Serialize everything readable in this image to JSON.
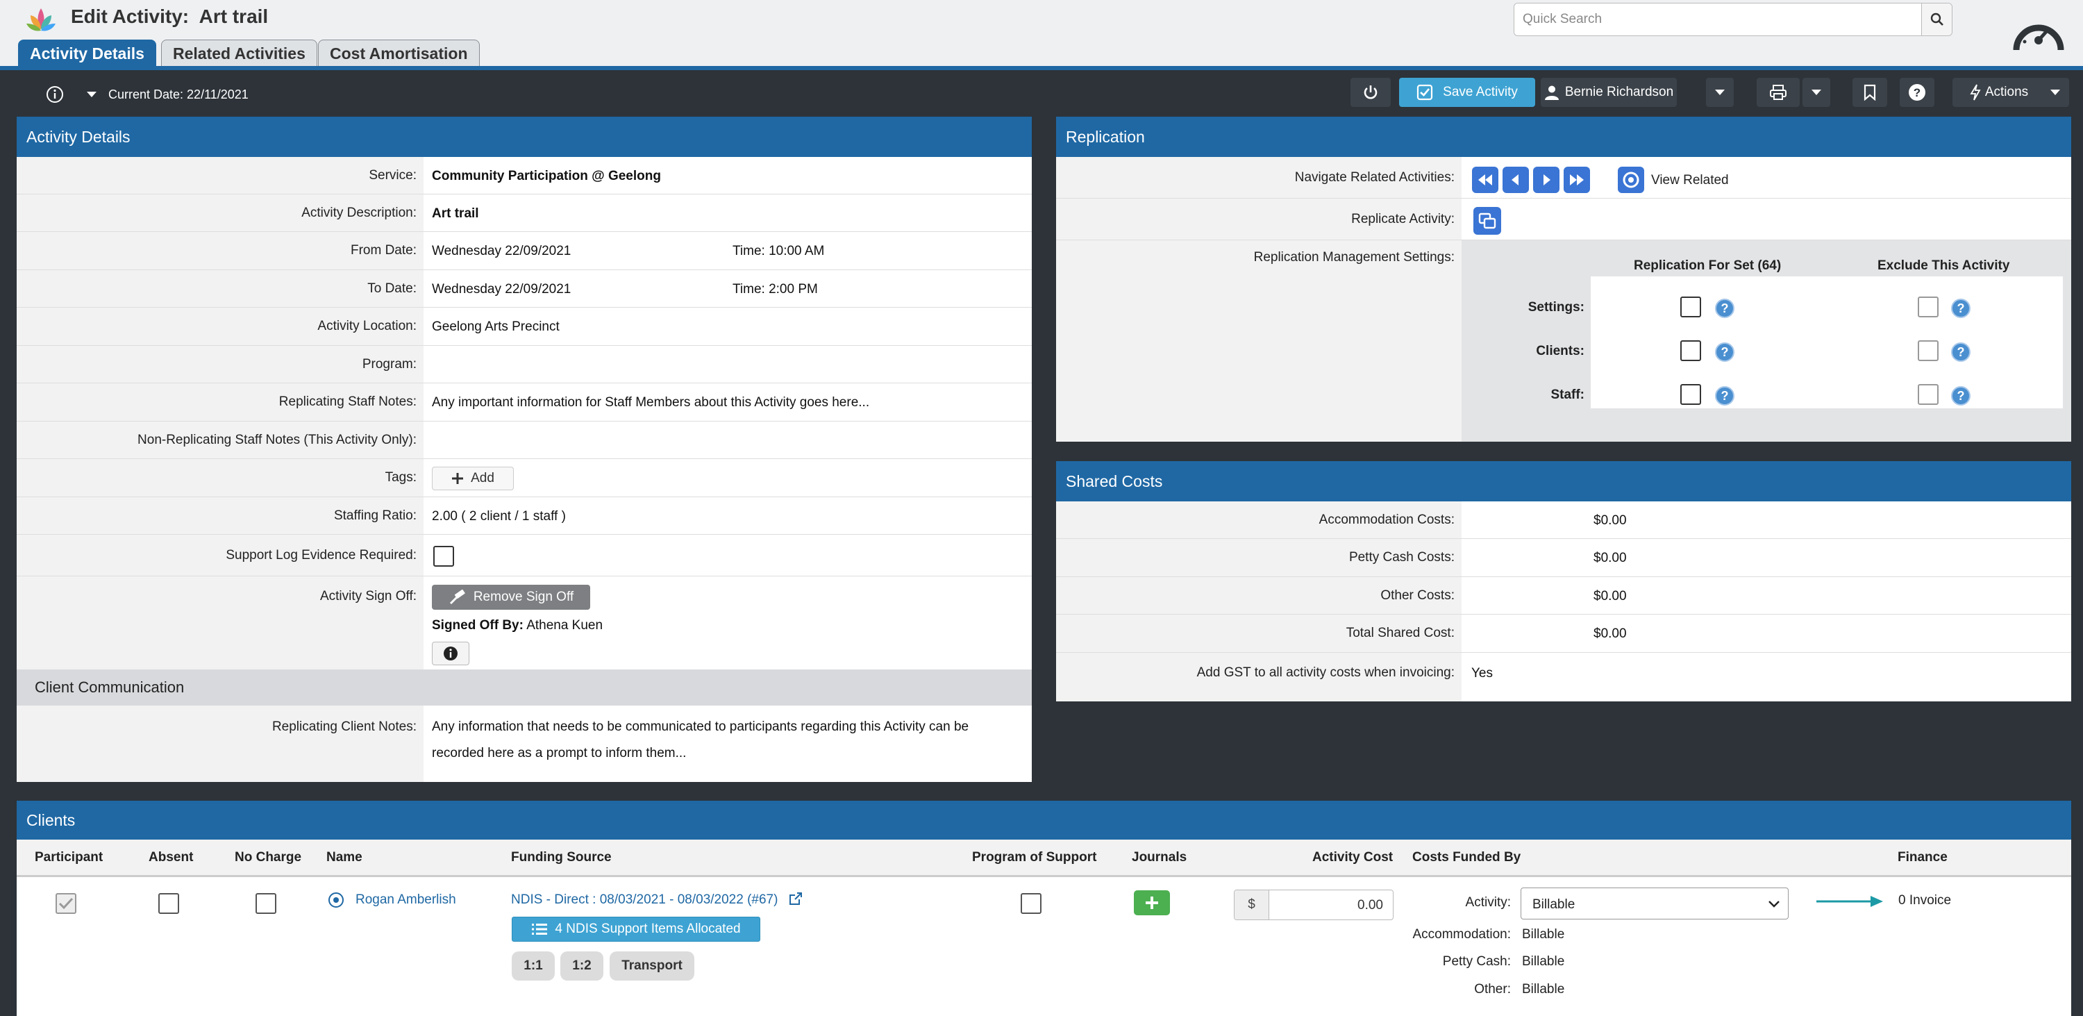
{
  "header": {
    "title_prefix": "Edit Activity:",
    "title_name": "Art trail",
    "search_placeholder": "Quick Search",
    "tabs": [
      {
        "label": "Activity Details"
      },
      {
        "label": "Related Activities"
      },
      {
        "label": "Cost Amortisation"
      }
    ]
  },
  "toolbar": {
    "current_date": "Current Date: 22/11/2021",
    "save_label": "Save Activity",
    "user_name": "Bernie Richardson",
    "actions_label": "Actions"
  },
  "activity_details": {
    "heading": "Activity Details",
    "service_label": "Service:",
    "service_value": "Community Participation @ Geelong",
    "description_label": "Activity Description:",
    "description_value": "Art trail",
    "from_label": "From Date:",
    "from_value": "Wednesday 22/09/2021",
    "from_time": "Time: 10:00 AM",
    "to_label": "To Date:",
    "to_value": "Wednesday 22/09/2021",
    "to_time": "Time: 2:00 PM",
    "location_label": "Activity Location:",
    "location_value": "Geelong Arts Precinct",
    "program_label": "Program:",
    "program_value": "",
    "rep_notes_label": "Replicating Staff Notes:",
    "rep_notes_value": "Any important information for Staff Members about this Activity goes here...",
    "nonrep_notes_label": "Non-Replicating Staff Notes (This Activity Only):",
    "nonrep_notes_value": "",
    "tags_label": "Tags:",
    "tags_add": "Add",
    "ratio_label": "Staffing Ratio:",
    "ratio_value": "2.00 ( 2 client / 1 staff )",
    "evidence_label": "Support Log Evidence Required:",
    "signoff_label": "Activity Sign Off:",
    "remove_signoff": "Remove Sign Off",
    "signed_off_by_label": "Signed Off By:",
    "signed_off_by_value": "Athena Kuen",
    "client_comm_heading": "Client Communication",
    "client_notes_label": "Replicating Client Notes:",
    "client_notes_line1": "Any information that needs to be communicated to participants regarding this Activity can be",
    "client_notes_line2": "recorded here as a prompt to inform them..."
  },
  "replication": {
    "heading": "Replication",
    "navigate_label": "Navigate Related Activities:",
    "view_related": "View Related",
    "replicate_label": "Replicate Activity:",
    "mgmt_label": "Replication Management Settings:",
    "col_set": "Replication For Set (64)",
    "col_exclude": "Exclude This Activity",
    "rows": [
      {
        "label": "Settings:"
      },
      {
        "label": "Clients:"
      },
      {
        "label": "Staff:"
      }
    ]
  },
  "shared_costs": {
    "heading": "Shared Costs",
    "rows": [
      {
        "label": "Accommodation Costs:",
        "value": "$0.00"
      },
      {
        "label": "Petty Cash Costs:",
        "value": "$0.00"
      },
      {
        "label": "Other Costs:",
        "value": "$0.00"
      },
      {
        "label": "Total Shared Cost:",
        "value": "$0.00"
      },
      {
        "label": "Add GST to all activity costs when invoicing:",
        "value": "Yes"
      }
    ]
  },
  "clients": {
    "heading": "Clients",
    "columns": {
      "participant": "Participant",
      "absent": "Absent",
      "no_charge": "No Charge",
      "name": "Name",
      "funding": "Funding Source",
      "program": "Program of Support",
      "journals": "Journals",
      "cost": "Activity Cost",
      "funded_by": "Costs Funded By",
      "finance": "Finance"
    },
    "row": {
      "name": "Rogan Amberlish",
      "funding": "NDIS - Direct : 08/03/2021 - 08/03/2022 (#67)",
      "support_items": "4 NDIS Support Items Allocated",
      "pills": [
        "1:1",
        "1:2",
        "Transport"
      ],
      "currency": "$",
      "cost": "0.00",
      "activity_label": "Activity:",
      "activity_value": "Billable",
      "accommodation_label": "Accommodation:",
      "accommodation_value": "Billable",
      "petty_label": "Petty Cash:",
      "petty_value": "Billable",
      "other_label": "Other:",
      "other_value": "Billable",
      "finance": "0 Invoice"
    }
  },
  "colors": {
    "header_blue": "#1f68a4",
    "save_blue": "#3ea3d3",
    "toolbar_dark": "#2d3339",
    "journal_green": "#4caf50"
  }
}
